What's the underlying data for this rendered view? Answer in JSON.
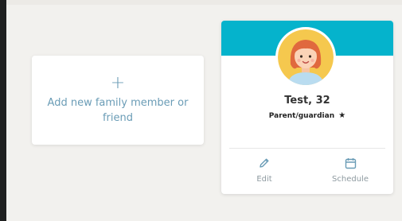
{
  "add_card": {
    "plus_symbol": "+",
    "label": "Add new family member or friend",
    "icon": "plus-icon"
  },
  "profile": {
    "name": "Test, 32",
    "role": "Parent/guardian",
    "role_star": "★",
    "avatar": "child-avatar-icon",
    "header_color": "#05b3cc",
    "actions": {
      "edit": {
        "label": "Edit",
        "icon": "pencil-icon"
      },
      "schedule": {
        "label": "Schedule",
        "icon": "calendar-icon"
      }
    }
  },
  "colors": {
    "accent": "#05b3cc",
    "link_blue": "#6a9cb6",
    "background": "#f2f1ee"
  }
}
